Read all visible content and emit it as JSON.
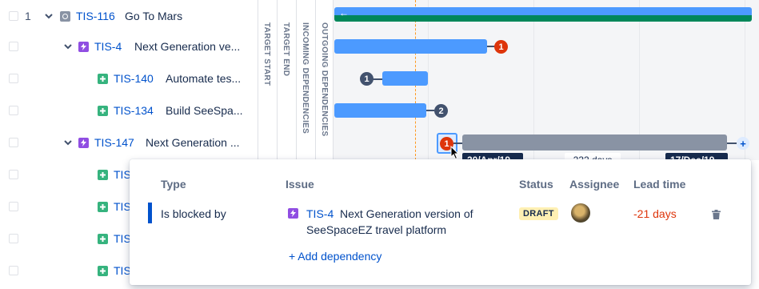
{
  "rows": [
    {
      "num": "1",
      "key": "TIS-116",
      "title": "Go To Mars",
      "type": "initiative-icon"
    },
    {
      "key": "TIS-4",
      "title": "Next Generation ve...",
      "type": "epic-icon"
    },
    {
      "key": "TIS-140",
      "title": "Automate tes...",
      "type": "story-icon"
    },
    {
      "key": "TIS-134",
      "title": "Build SeeSpa...",
      "type": "story-icon"
    },
    {
      "key": "TIS-147",
      "title": "Next Generation ...",
      "type": "epic-icon"
    },
    {
      "key": "TIS",
      "type": "story-icon"
    },
    {
      "key": "TIS",
      "type": "story-icon"
    },
    {
      "key": "TIS",
      "type": "story-icon"
    },
    {
      "key": "TIS",
      "type": "story-icon"
    }
  ],
  "columns": [
    "TARGET START",
    "TARGET END",
    "INCOMING DEPENDENCIES",
    "OUTGOING DEPENDENCIES"
  ],
  "timeline": {
    "badges": {
      "tis4_out": "1",
      "tis140_in": "1",
      "tis134_out": "2",
      "tis147_in": "1"
    },
    "start_date": "20/Apr/19",
    "duration": "232 days",
    "end_date": "17/Dec/19",
    "add": "+",
    "back_arrow": "←"
  },
  "popup": {
    "headers": {
      "type": "Type",
      "issue": "Issue",
      "status": "Status",
      "assignee": "Assignee",
      "lead_time": "Lead time"
    },
    "row": {
      "relation": "Is blocked by",
      "issue_key": "TIS-4",
      "issue_title": "Next Generation version of SeeSpaceEZ travel platform",
      "status": "DRAFT",
      "lead_time": "-21 days"
    },
    "add_dependency": "+ Add dependency"
  },
  "colors": {
    "bar": "#4c9aff",
    "green_bar": "#00875a",
    "badge_red": "#de350b",
    "link": "#0052cc",
    "draft_bg": "#fff0b3"
  }
}
